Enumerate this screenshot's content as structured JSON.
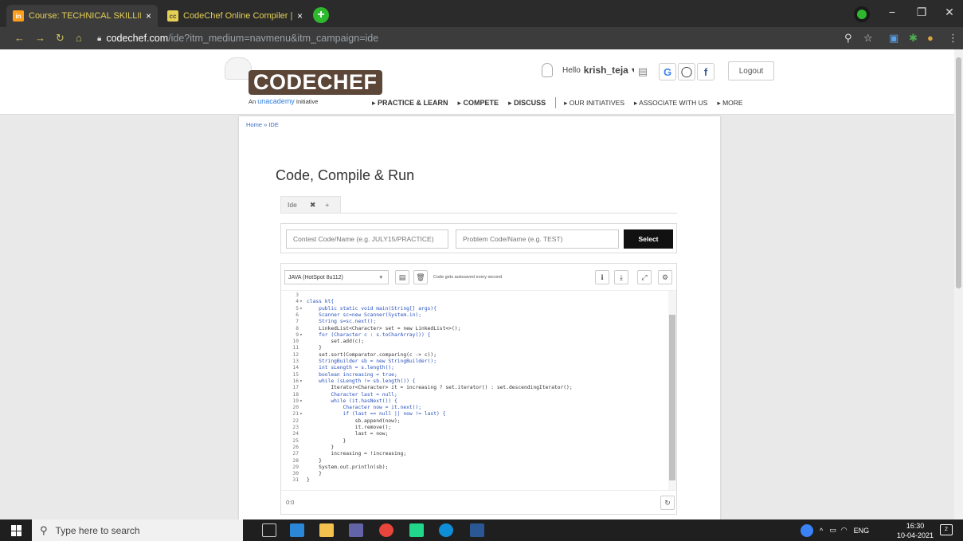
{
  "browser": {
    "tabs": [
      {
        "favicon": "in",
        "title": "Course: TECHNICAL SKILLING (P...",
        "close": "×"
      },
      {
        "favicon": "cc",
        "title": "CodeChef Online Compiler | Ide...",
        "close": "×"
      }
    ],
    "new_tab": "+",
    "url_host": "codechef.com",
    "url_path": "/ide?itm_medium=navmenu&itm_campaign=ide",
    "window_controls": {
      "minimize": "−",
      "maximize": "❐",
      "close": "✕"
    }
  },
  "site": {
    "logo_text": "CODECHEF",
    "logo_tag_prefix": "An",
    "logo_tag_brand": "unacademy",
    "logo_tag_suffix": "Initiative",
    "hello_prefix": "Hello",
    "username": "krish_teja",
    "username_caret": "▾",
    "social": {
      "google": "G",
      "github": "◯",
      "facebook": "f"
    },
    "logout": "Logout",
    "menu": [
      {
        "label": "▸ PRACTICE & LEARN",
        "big": true
      },
      {
        "label": "▸ COMPETE",
        "big": true
      },
      {
        "label": "▸ DISCUSS",
        "big": true
      },
      {
        "label": "▸ OUR INITIATIVES",
        "big": false
      },
      {
        "label": "▸ ASSOCIATE WITH US",
        "big": false
      },
      {
        "label": "▸ MORE",
        "big": false
      }
    ]
  },
  "ide": {
    "breadcrumb": "Home » IDE",
    "title": "Code, Compile & Run",
    "tab_label": "Ide",
    "tab_close": "✖",
    "tab_add": "+",
    "contest_placeholder": "Contest Code/Name (e.g. JULY15/PRACTICE)",
    "problem_placeholder": "Problem Code/Name (e.g. TEST)",
    "select_label": "Select",
    "language": "JAVA (HotSpot 8u112)",
    "language_caret": "▾",
    "autosave_note": "Code gets autosaved every second",
    "cursor_position": "0:0",
    "code_lines": [
      {
        "n": "3",
        "fold": "",
        "code": ""
      },
      {
        "n": "4",
        "fold": "▾",
        "code": "class kt{"
      },
      {
        "n": "5",
        "fold": "▾",
        "code": "    public static void main(String[] args){"
      },
      {
        "n": "6",
        "fold": "",
        "code": "    Scanner sc=new Scanner(System.in);"
      },
      {
        "n": "7",
        "fold": "",
        "code": "    String s=sc.next();"
      },
      {
        "n": "8",
        "fold": "",
        "code": "    LinkedList<Character> set = new LinkedList<>();"
      },
      {
        "n": "9",
        "fold": "▾",
        "code": "    for (Character c : s.toCharArray()) {"
      },
      {
        "n": "10",
        "fold": "",
        "code": "        set.add(c);"
      },
      {
        "n": "11",
        "fold": "",
        "code": "    }"
      },
      {
        "n": "12",
        "fold": "",
        "code": "    set.sort(Comparator.comparing(c -> c));"
      },
      {
        "n": "13",
        "fold": "",
        "code": "    StringBuilder sb = new StringBuilder();"
      },
      {
        "n": "14",
        "fold": "",
        "code": "    int sLength = s.length();"
      },
      {
        "n": "15",
        "fold": "",
        "code": "    boolean increasing = true;"
      },
      {
        "n": "16",
        "fold": "▾",
        "code": "    while (sLength != sb.length()) {"
      },
      {
        "n": "17",
        "fold": "",
        "code": "        Iterator<Character> it = increasing ? set.iterator() : set.descendingIterator();"
      },
      {
        "n": "18",
        "fold": "",
        "code": "        Character last = null;"
      },
      {
        "n": "19",
        "fold": "▾",
        "code": "        while (it.hasNext()) {"
      },
      {
        "n": "20",
        "fold": "",
        "code": "            Character now = it.next();"
      },
      {
        "n": "21",
        "fold": "▾",
        "code": "            if (last == null || now != last) {"
      },
      {
        "n": "22",
        "fold": "",
        "code": "                sb.append(now);"
      },
      {
        "n": "23",
        "fold": "",
        "code": "                it.remove();"
      },
      {
        "n": "24",
        "fold": "",
        "code": "                last = now;"
      },
      {
        "n": "25",
        "fold": "",
        "code": "            }"
      },
      {
        "n": "26",
        "fold": "",
        "code": "        }"
      },
      {
        "n": "27",
        "fold": "",
        "code": "        increasing = !increasing;"
      },
      {
        "n": "28",
        "fold": "",
        "code": "    }"
      },
      {
        "n": "29",
        "fold": "",
        "code": "    System.out.println(sb);"
      },
      {
        "n": "30",
        "fold": "",
        "code": "    }"
      },
      {
        "n": "31",
        "fold": "",
        "code": "}"
      }
    ]
  },
  "taskbar": {
    "search_placeholder": "Type here to search",
    "language": "ENG",
    "time": "16:30",
    "date": "10-04-2021",
    "notifications": "2"
  },
  "colors": {
    "chrome_dark": "#2b2b2b",
    "tab_text": "#e5d055",
    "codechef_brown": "#5b4638",
    "keyword_blue": "#2a52be",
    "select_button": "#111111"
  }
}
